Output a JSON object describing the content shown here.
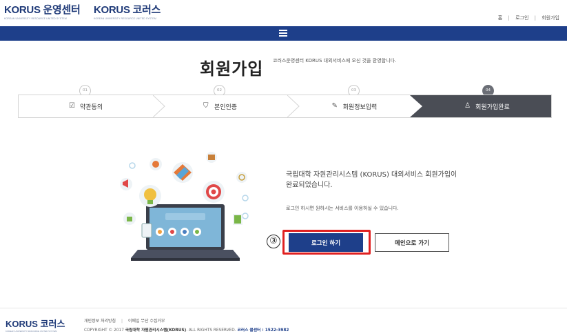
{
  "header": {
    "logo_main": "KORUS 운영센터",
    "logo_main_sub": "KOREAN UNIVERSITY RESOURCE UNITED SYSTEM",
    "logo_secondary": "KORUS 코러스",
    "logo_secondary_sub": "KOREAN UNIVERSITY RESOURCE UNITED SYSTEM",
    "links": [
      "홈",
      "로그인",
      "회원가입"
    ]
  },
  "page": {
    "title": "회원가입",
    "subtitle": "코러스운영센터 KORUS 대외서비스에 오신 것을 환영합니다."
  },
  "steps": [
    {
      "number": "01",
      "label": "약관동의",
      "icon": "checkbox-icon"
    },
    {
      "number": "02",
      "label": "본인인증",
      "icon": "shield-check-icon"
    },
    {
      "number": "03",
      "label": "회원정보입력",
      "icon": "edit-icon"
    },
    {
      "number": "04",
      "label": "회원가입완료",
      "icon": "user-icon",
      "active": true
    }
  ],
  "message": {
    "main": "국립대학 자원관리시스템 (KORUS) 대외서비스 회원가입이 완료되었습니다.",
    "sub": "로그인 하시면 원하시는 서비스를 이용하실 수 있습니다."
  },
  "buttons": {
    "login": "로그인 하기",
    "main": "메인으로 가기"
  },
  "annotation": {
    "marker": "③"
  },
  "footer": {
    "logo": "KORUS 코러스",
    "logo_sub": "KOREAN UNIVERSITY RESOURCE UNITED SYSTEM",
    "links": [
      "개인정보 처리방침",
      "이메일 무단 수집거부"
    ],
    "copyright_prefix": "COPYRIGHT © 2017",
    "copyright_org": "국립대학 자원관리시스템(KORUS)",
    "copyright_rights": ". ALL RIGHTS RESERVED.",
    "callcenter": "코러스 콜센터 : 1522-3982"
  },
  "colors": {
    "navy": "#1e3f8a",
    "active_step": "#4a4d55",
    "highlight": "#e02020"
  }
}
